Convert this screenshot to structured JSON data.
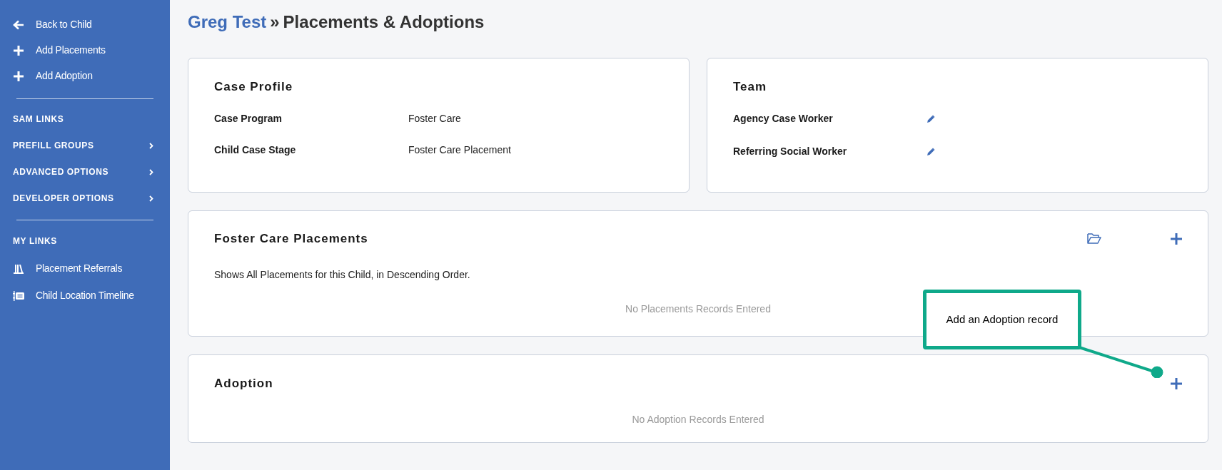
{
  "sidebar": {
    "actions": [
      {
        "kind": "back",
        "label": "Back to Child"
      },
      {
        "kind": "add",
        "label": "Add Placements"
      },
      {
        "kind": "add",
        "label": "Add Adoption"
      }
    ],
    "sections": [
      {
        "title": "SAM LINKS",
        "expandable": false
      },
      {
        "title": "PREFILL GROUPS",
        "expandable": true
      },
      {
        "title": "ADVANCED OPTIONS",
        "expandable": true
      },
      {
        "title": "DEVELOPER OPTIONS",
        "expandable": true
      }
    ],
    "my_links_title": "MY LINKS",
    "my_links": [
      {
        "kind": "referrals",
        "label": "Placement Referrals"
      },
      {
        "kind": "timeline",
        "label": "Child Location Timeline"
      }
    ]
  },
  "header": {
    "child_name": "Greg Test",
    "separator": "»",
    "title": "Placements & Adoptions"
  },
  "case_profile": {
    "title": "Case Profile",
    "fields": [
      {
        "label": "Case Program",
        "value": "Foster Care"
      },
      {
        "label": "Child Case Stage",
        "value": "Foster Care Placement"
      }
    ]
  },
  "team": {
    "title": "Team",
    "fields": [
      {
        "label": "Agency Case Worker"
      },
      {
        "label": "Referring Social Worker"
      }
    ]
  },
  "placements": {
    "title": "Foster Care Placements",
    "description": "Shows All Placements for this Child, in Descending Order.",
    "empty": "No Placements Records Entered"
  },
  "adoption": {
    "title": "Adoption",
    "empty": "No Adoption Records Entered"
  },
  "callout": {
    "text": "Add an Adoption record"
  }
}
